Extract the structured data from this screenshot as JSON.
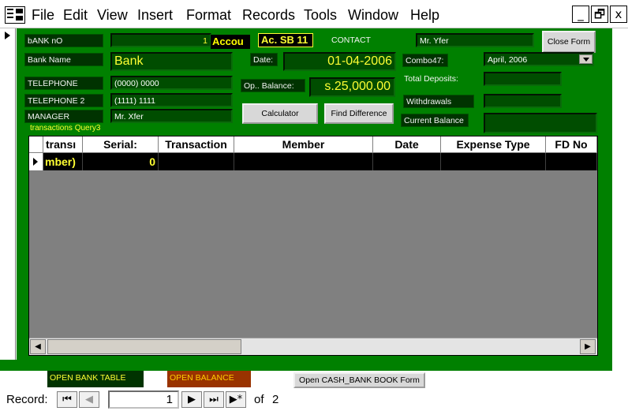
{
  "menu": {
    "items": [
      "File",
      "Edit",
      "View",
      "Insert",
      "Format",
      "Records",
      "Tools",
      "Window",
      "Help"
    ],
    "minimize": "_",
    "restore": "🗗",
    "close": "x"
  },
  "form": {
    "bank_no": {
      "label": "bANK nO",
      "value": "1"
    },
    "account_label": "Accou",
    "account_value": "Ac. SB 11",
    "contact": {
      "label": "CONTACT",
      "value": "Mr. Yfer"
    },
    "close_button": "Close Form",
    "bank_name": {
      "label": "Bank Name",
      "value": "Bank"
    },
    "date": {
      "label": "Date:",
      "value": "01-04-2006"
    },
    "combo": {
      "label": "Combo47:",
      "value": "April, 2006"
    },
    "telephone": {
      "label": "TELEPHONE",
      "value": "(0000) 0000"
    },
    "op_balance": {
      "label": "Op.. Balance:",
      "value": "s.25,000.00"
    },
    "total_deposits": {
      "label": "Total Deposits:",
      "value": ""
    },
    "telephone2": {
      "label": "TELEPHONE 2",
      "value": "(1111) 1111"
    },
    "withdrawals": {
      "label": "Withdrawals",
      "value": ""
    },
    "manager": {
      "label": "MANAGER",
      "value": "Mr. Xfer"
    },
    "calculator_button": "Calculator",
    "find_difference_button": "Find Difference",
    "current_balance": {
      "label": "Current Balance",
      "value": ""
    },
    "subform_label": "transactions Query3"
  },
  "grid": {
    "columns": [
      "transı",
      "Serial:",
      "Transaction",
      "Member",
      "Date",
      "Expense Type",
      "FD No"
    ],
    "row": [
      "mber)",
      "0",
      "",
      "",
      "",
      "",
      ""
    ]
  },
  "footer": {
    "open_bank_table": "OPEN BANK TABLE",
    "open_balance": "OPEN BALANCE",
    "open_cash_bank": "Open CASH_BANK BOOK Form"
  },
  "navigation": {
    "label": "Record:",
    "current": "1",
    "of_label": "of",
    "total": "2"
  },
  "colors": {
    "form_bg": "#008000",
    "field_text": "#ffff33"
  }
}
